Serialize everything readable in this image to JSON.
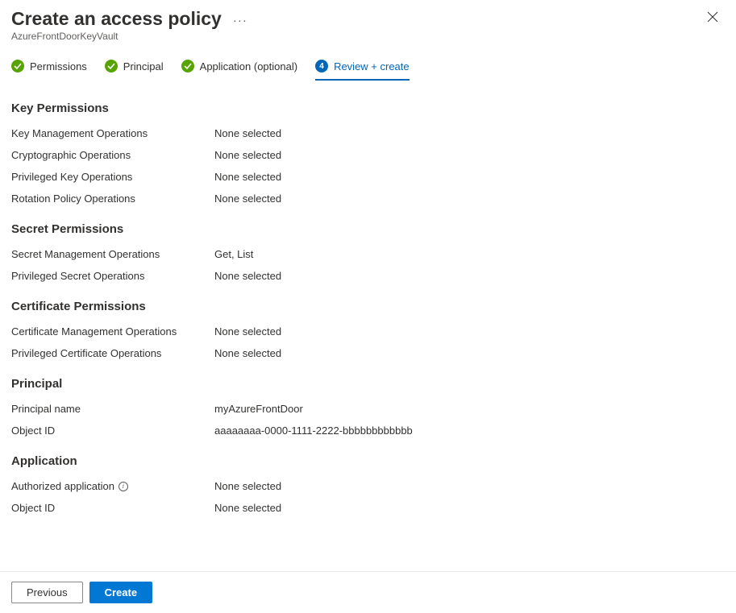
{
  "header": {
    "title": "Create an access policy",
    "subtitle": "AzureFrontDoorKeyVault"
  },
  "tabs": [
    {
      "label": "Permissions",
      "state": "done"
    },
    {
      "label": "Principal",
      "state": "done"
    },
    {
      "label": "Application (optional)",
      "state": "done"
    },
    {
      "label": "Review + create",
      "state": "active",
      "number": "4"
    }
  ],
  "sections": {
    "key_permissions": {
      "heading": "Key Permissions",
      "rows": [
        {
          "label": "Key Management Operations",
          "value": "None selected"
        },
        {
          "label": "Cryptographic Operations",
          "value": "None selected"
        },
        {
          "label": "Privileged Key Operations",
          "value": "None selected"
        },
        {
          "label": "Rotation Policy Operations",
          "value": "None selected"
        }
      ]
    },
    "secret_permissions": {
      "heading": "Secret Permissions",
      "rows": [
        {
          "label": "Secret Management Operations",
          "value": "Get, List"
        },
        {
          "label": "Privileged Secret Operations",
          "value": "None selected"
        }
      ]
    },
    "certificate_permissions": {
      "heading": "Certificate Permissions",
      "rows": [
        {
          "label": "Certificate Management Operations",
          "value": "None selected"
        },
        {
          "label": "Privileged Certificate Operations",
          "value": "None selected"
        }
      ]
    },
    "principal": {
      "heading": "Principal",
      "rows": [
        {
          "label": "Principal name",
          "value": "myAzureFrontDoor"
        },
        {
          "label": "Object ID",
          "value": "aaaaaaaa-0000-1111-2222-bbbbbbbbbbbb"
        }
      ]
    },
    "application": {
      "heading": "Application",
      "rows": [
        {
          "label": "Authorized application",
          "value": "None selected",
          "info": true
        },
        {
          "label": "Object ID",
          "value": "None selected"
        }
      ]
    }
  },
  "footer": {
    "previous_label": "Previous",
    "create_label": "Create"
  }
}
